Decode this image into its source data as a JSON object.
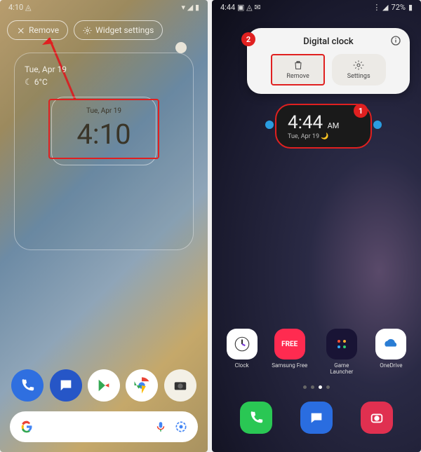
{
  "left": {
    "status": {
      "time": "4:10",
      "icons": "▾ ◢ ▮"
    },
    "toolbar": {
      "remove": "Remove",
      "widget_settings": "Widget settings"
    },
    "weather": {
      "date": "Tue, Apr 19",
      "temp": "6°C"
    },
    "clock": {
      "date": "Tue, Apr 19",
      "time": "4:10"
    },
    "dock": [
      "Phone",
      "Messages",
      "Play Store",
      "Chrome",
      "Camera"
    ],
    "search": {
      "placeholder": ""
    }
  },
  "right": {
    "status": {
      "time": "4:44",
      "battery": "72%"
    },
    "popup": {
      "title": "Digital clock",
      "remove": "Remove",
      "settings": "Settings"
    },
    "widget": {
      "time": "4:44",
      "ampm": "AM",
      "date": "Tue, Apr 19"
    },
    "annotations": {
      "b1": "1",
      "b2": "2"
    },
    "apps": [
      {
        "label": "Clock"
      },
      {
        "label": "Samsung Free"
      },
      {
        "label": "Game Launcher"
      },
      {
        "label": "OneDrive"
      }
    ],
    "dock": [
      "Phone",
      "Messages",
      "Camera"
    ]
  }
}
